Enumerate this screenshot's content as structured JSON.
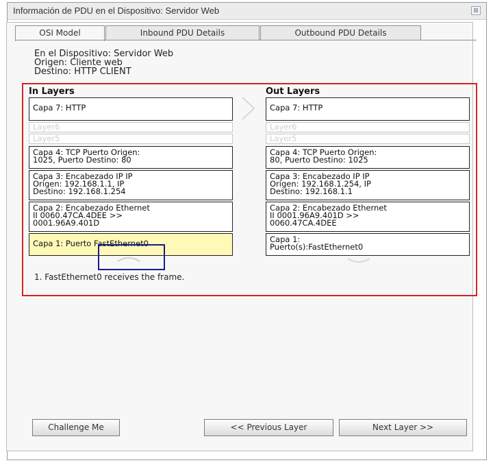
{
  "window": {
    "title": "Información de PDU en el Dispositivo: Servidor Web",
    "close_icon": "close-icon"
  },
  "tabs": [
    {
      "label": "OSI Model",
      "active": true
    },
    {
      "label": "Inbound PDU Details",
      "active": false
    },
    {
      "label": "Outbound PDU Details",
      "active": false
    }
  ],
  "info": {
    "device": "En el Dispositivo: Servidor Web",
    "source": "Origen: Cliente web",
    "destination": "Destino: HTTP CLIENT"
  },
  "in_layers": {
    "header": "In Layers",
    "layers": [
      "Capa 7: HTTP",
      "Layer6",
      "Layer5",
      "Capa 4: TCP Puerto Origen:\n1025, Puerto Destino: 80",
      "Capa 3: Encabezado IP IP\nOrigen: 192.168.1.1, IP\nDestino: 192.168.1.254",
      "Capa 2: Encabezado Ethernet\nII 0060.47CA.4DEE >>\n0001.96A9.401D",
      "Capa 1: Puerto FastEthernet0"
    ]
  },
  "out_layers": {
    "header": "Out Layers",
    "layers": [
      "Capa 7: HTTP",
      "Layer6",
      "Layer5",
      "Capa 4: TCP Puerto Origen:\n80, Puerto Destino: 1025",
      "Capa 3: Encabezado IP IP\nOrigen: 192.168.1.254, IP\nDestino: 192.168.1.1",
      "Capa 2: Encabezado Ethernet\nII 0001.96A9.401D >>\n0060.47CA.4DEE",
      "Capa 1:\nPuerto(s):FastEthernet0"
    ]
  },
  "status": "1. FastEthernet0 receives the frame.",
  "buttons": {
    "challenge": "Challenge Me",
    "previous": "<< Previous Layer",
    "next": "Next Layer >>"
  },
  "colors": {
    "annotation_box": "#d32323",
    "highlight": "#fff9b8",
    "focus_box": "#1a1a8c"
  }
}
